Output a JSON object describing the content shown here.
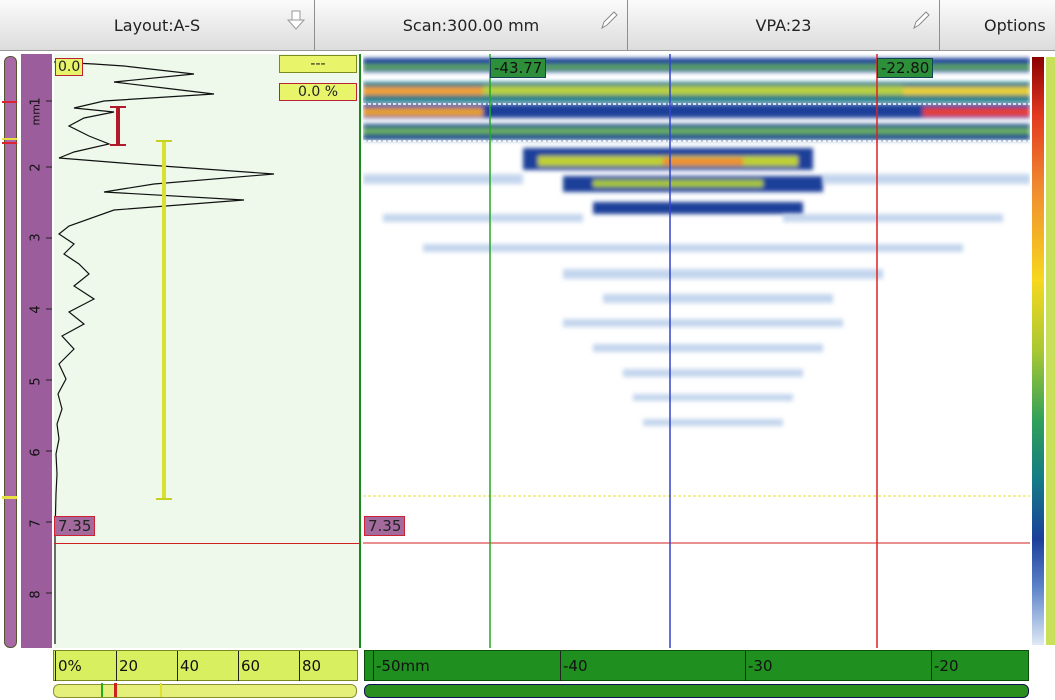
{
  "toolbar": {
    "layout_label": "Layout:A-S",
    "scan_label": "Scan:300.00 mm",
    "vpa_label": "VPA:23",
    "options_label": "Options"
  },
  "depth_ruler": {
    "unit": "mm",
    "labels": [
      "1",
      "2",
      "3",
      "4",
      "5",
      "6",
      "7",
      "8"
    ]
  },
  "ascan": {
    "gate_top_readout": "0.0",
    "gate_dash": "---",
    "amplitude_readout": "0.0 %",
    "cursor_depth": "7.35",
    "amplitude_axis_labels": [
      "0%",
      "20",
      "40",
      "60",
      "80"
    ]
  },
  "sscan": {
    "cursor_depth": "7.35",
    "left_cursor": "-43.77",
    "right_cursor": "-22.80",
    "axis_labels": [
      "-50mm",
      "-40",
      "-30",
      "-20"
    ]
  },
  "colors": {
    "gate_red": "#c8102e",
    "gate_yellow": "#d8e030",
    "cursor_green": "#22aa22",
    "cursor_blue": "#3344cc"
  }
}
